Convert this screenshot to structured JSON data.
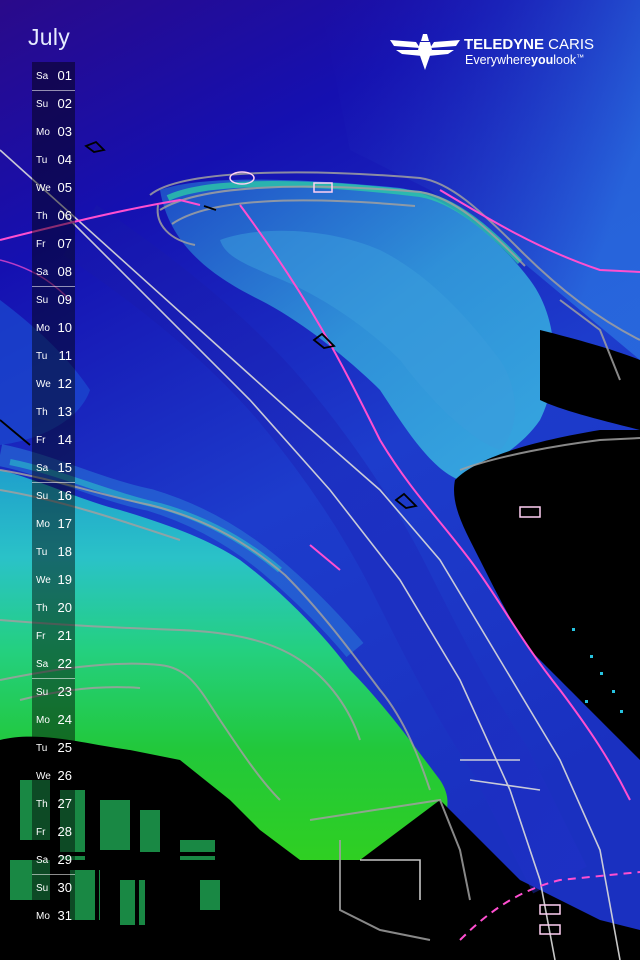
{
  "calendar": {
    "month": "July",
    "days": [
      {
        "wd": "Sa",
        "d": "01"
      },
      {
        "wd": "Su",
        "d": "02"
      },
      {
        "wd": "Mo",
        "d": "03"
      },
      {
        "wd": "Tu",
        "d": "04"
      },
      {
        "wd": "We",
        "d": "05"
      },
      {
        "wd": "Th",
        "d": "06"
      },
      {
        "wd": "Fr",
        "d": "07"
      },
      {
        "wd": "Sa",
        "d": "08"
      },
      {
        "wd": "Su",
        "d": "09"
      },
      {
        "wd": "Mo",
        "d": "10"
      },
      {
        "wd": "Tu",
        "d": "11"
      },
      {
        "wd": "We",
        "d": "12"
      },
      {
        "wd": "Th",
        "d": "13"
      },
      {
        "wd": "Fr",
        "d": "14"
      },
      {
        "wd": "Sa",
        "d": "15"
      },
      {
        "wd": "Su",
        "d": "16"
      },
      {
        "wd": "Mo",
        "d": "17"
      },
      {
        "wd": "Tu",
        "d": "18"
      },
      {
        "wd": "We",
        "d": "19"
      },
      {
        "wd": "Th",
        "d": "20"
      },
      {
        "wd": "Fr",
        "d": "21"
      },
      {
        "wd": "Sa",
        "d": "22"
      },
      {
        "wd": "Su",
        "d": "23"
      },
      {
        "wd": "Mo",
        "d": "24"
      },
      {
        "wd": "Tu",
        "d": "25"
      },
      {
        "wd": "We",
        "d": "26"
      },
      {
        "wd": "Th",
        "d": "27"
      },
      {
        "wd": "Fr",
        "d": "28"
      },
      {
        "wd": "Sa",
        "d": "29"
      },
      {
        "wd": "Su",
        "d": "30"
      },
      {
        "wd": "Mo",
        "d": "31"
      }
    ]
  },
  "logo": {
    "brand_bold": "TELEDYNE",
    "brand_light": " CARIS",
    "tag_a": "Everywhere",
    "tag_b": "you",
    "tag_c": "look",
    "tag_tm": "™"
  },
  "colors": {
    "deep_water": "#1410a8",
    "mid_water": "#1f48cc",
    "shallow": "#2fb8d8",
    "shoal": "#23c838",
    "land": "#000000",
    "channel_line": "#ff4fd0",
    "contour": "#9a9a9a"
  }
}
